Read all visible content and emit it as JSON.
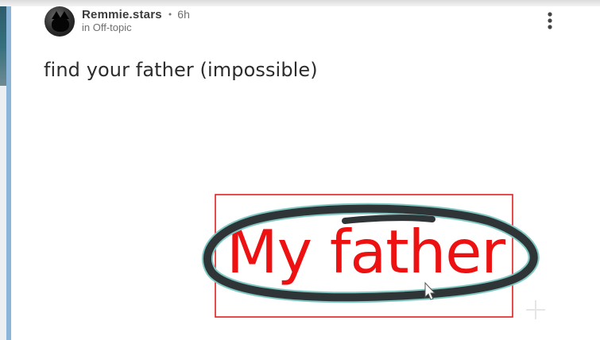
{
  "post": {
    "author": "Remmie.stars",
    "separator": "•",
    "time": "6h",
    "community": "in Off-topic",
    "title": "find your father (impossible)",
    "image_caption": "My father"
  },
  "icons": {
    "more": "vertical-ellipsis-icon",
    "cursor": "mouse-pointer-icon",
    "crosshair": "plus-crosshair-icon"
  },
  "colors": {
    "caption_red": "#ee1111",
    "frame_red": "#e02020",
    "circle_stroke": "#2f3437",
    "circle_outline": "#7fc8c4"
  }
}
